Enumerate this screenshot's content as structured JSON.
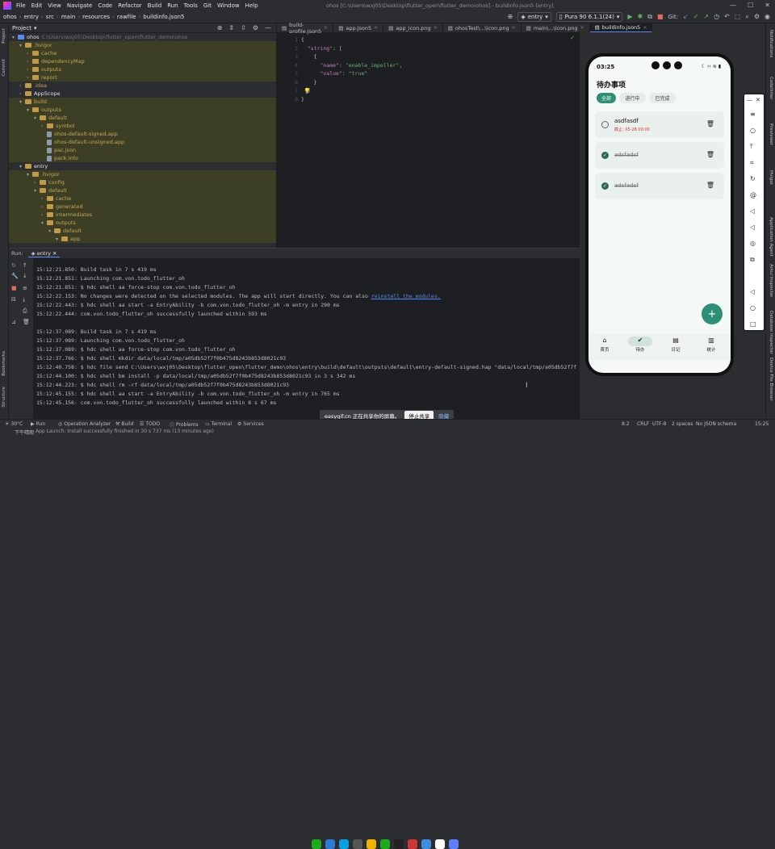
{
  "menubar": {
    "items": [
      "File",
      "Edit",
      "View",
      "Navigate",
      "Code",
      "Refactor",
      "Build",
      "Run",
      "Tools",
      "Git",
      "Window",
      "Help"
    ],
    "title": "ohos [C:\\Users\\wxj05\\Desktop\\flutter_open\\flutter_demo\\ohos] - buildinfo.json5 [entry]"
  },
  "nav": {
    "crumbs": [
      "ohos",
      "entry",
      "src",
      "main",
      "resources",
      "rawfile",
      "buildinfo.json5"
    ],
    "module": "entry",
    "device": "Pura 90 6.1.1(24)",
    "git": "Git:"
  },
  "project": {
    "title": "Project",
    "rows": [
      {
        "d": 0,
        "a": "▾",
        "t": "ohos",
        "sub": "C:\\Users\\wxj05\\Desktop\\flutter_open\\flutter_demo\\ohos",
        "k": "fold",
        "hl": false,
        "dim": false
      },
      {
        "d": 1,
        "a": "▾",
        "t": ".hvigor",
        "k": "fold",
        "hl": true,
        "dim": true
      },
      {
        "d": 2,
        "a": "›",
        "t": "cache",
        "k": "fold",
        "hl": true,
        "dim": true
      },
      {
        "d": 2,
        "a": "›",
        "t": "dependencyMap",
        "k": "fold",
        "hl": true,
        "dim": true
      },
      {
        "d": 2,
        "a": "›",
        "t": "outputs",
        "k": "fold",
        "hl": true,
        "dim": true
      },
      {
        "d": 2,
        "a": "›",
        "t": "report",
        "k": "fold",
        "hl": true,
        "dim": true
      },
      {
        "d": 1,
        "a": "›",
        "t": ".idea",
        "k": "fold",
        "hl": false,
        "dim": true
      },
      {
        "d": 1,
        "a": "›",
        "t": "AppScope",
        "k": "fold",
        "hl": false,
        "dim": false
      },
      {
        "d": 1,
        "a": "▾",
        "t": "build",
        "k": "fold",
        "hl": true,
        "dim": true
      },
      {
        "d": 2,
        "a": "▾",
        "t": "outputs",
        "k": "fold",
        "hl": true,
        "dim": true
      },
      {
        "d": 3,
        "a": "▾",
        "t": "default",
        "k": "fold",
        "hl": true,
        "dim": true
      },
      {
        "d": 4,
        "a": "›",
        "t": "symbol",
        "k": "fold",
        "hl": true,
        "dim": true
      },
      {
        "d": 4,
        "a": "",
        "t": "ohos-default-signed.app",
        "k": "file",
        "hl": true,
        "dim": true
      },
      {
        "d": 4,
        "a": "",
        "t": "ohos-default-unsigned.app",
        "k": "file",
        "hl": true,
        "dim": true
      },
      {
        "d": 4,
        "a": "",
        "t": "pac.json",
        "k": "file",
        "hl": true,
        "dim": true
      },
      {
        "d": 4,
        "a": "",
        "t": "pack.info",
        "k": "file",
        "hl": true,
        "dim": true
      },
      {
        "d": 1,
        "a": "▾",
        "t": "entry",
        "k": "fold",
        "hl": false,
        "dim": false
      },
      {
        "d": 2,
        "a": "▾",
        "t": ".hvigor",
        "k": "fold",
        "hl": true,
        "dim": true
      },
      {
        "d": 3,
        "a": "›",
        "t": "config",
        "k": "fold",
        "hl": true,
        "dim": true
      },
      {
        "d": 3,
        "a": "▾",
        "t": "default",
        "k": "fold",
        "hl": true,
        "dim": true
      },
      {
        "d": 4,
        "a": "›",
        "t": "cache",
        "k": "fold",
        "hl": true,
        "dim": true
      },
      {
        "d": 4,
        "a": "›",
        "t": "generated",
        "k": "fold",
        "hl": true,
        "dim": true
      },
      {
        "d": 4,
        "a": "›",
        "t": "intermediates",
        "k": "fold",
        "hl": true,
        "dim": true
      },
      {
        "d": 4,
        "a": "▾",
        "t": "outputs",
        "k": "fold",
        "hl": true,
        "dim": true
      },
      {
        "d": 5,
        "a": "▾",
        "t": "default",
        "k": "fold",
        "hl": true,
        "dim": true
      },
      {
        "d": 6,
        "a": "▾",
        "t": "app",
        "k": "fold",
        "hl": true,
        "dim": true
      }
    ]
  },
  "tabs": [
    {
      "t": "build-profile.json5",
      "a": false
    },
    {
      "t": "app.json5",
      "a": false
    },
    {
      "t": "app_icon.png",
      "a": false
    },
    {
      "t": "ohosTest\\...\\icon.png",
      "a": false
    },
    {
      "t": "main\\...\\icon.png",
      "a": false
    },
    {
      "t": "buildinfo.json5",
      "a": true
    }
  ],
  "code": [
    {
      "n": "1",
      "p": [
        {
          "c": "br",
          "t": "{"
        }
      ]
    },
    {
      "n": "2",
      "p": [
        {
          "c": "key",
          "t": "  \"string\""
        },
        {
          "c": "br",
          "t": ": ["
        }
      ]
    },
    {
      "n": "3",
      "p": [
        {
          "c": "br",
          "t": "    {"
        }
      ]
    },
    {
      "n": "4",
      "p": [
        {
          "c": "key",
          "t": "      \"name\""
        },
        {
          "c": "br",
          "t": ": "
        },
        {
          "c": "str",
          "t": "\"enable_impeller\""
        },
        {
          "c": "br",
          "t": ","
        }
      ]
    },
    {
      "n": "5",
      "p": [
        {
          "c": "key",
          "t": "      \"value\""
        },
        {
          "c": "br",
          "t": ": "
        },
        {
          "c": "str",
          "t": "\"true\""
        }
      ]
    },
    {
      "n": "6",
      "p": [
        {
          "c": "br",
          "t": "    }"
        }
      ]
    },
    {
      "n": "7",
      "p": [
        {
          "c": "br",
          "t": "  ]"
        }
      ]
    },
    {
      "n": "8",
      "p": [
        {
          "c": "br",
          "t": "}"
        }
      ]
    }
  ],
  "run": {
    "label": "Run:",
    "config": "entry",
    "log": [
      "15:12:21.850: Build task in 7 s 419 ms",
      "15:12:21.851: Launching com.von.todo_flutter_oh",
      "15:12:21.851: $ hdc shell aa force-stop com.von.todo_flutter_oh",
      "15:12:22.153: No changes were detected on the selected modules. The app will start directly. You can also ",
      "15:12:22.443: $ hdc shell aa start -a EntryAbility -b com.von.todo_flutter_oh -m entry in 290 ms",
      "15:12:22.444: com.von.todo_flutter_oh successfully launched within 593 ms",
      "",
      "15:12:37.089: Build task in 7 s 419 ms",
      "15:12:37.089: Launching com.von.todo_flutter_oh",
      "15:12:37.089: $ hdc shell aa force-stop com.von.todo_flutter_oh",
      "15:12:37.766: $ hdc shell mkdir data/local/tmp/a05db52f7f0b475d8243b853d8021c93",
      "15:12:40.758: $ hdc file send C:\\Users\\wxj05\\Desktop\\flutter_open\\flutter_demo\\ohos\\entry\\build\\default\\outputs\\default\\entry-default-signed.hap \"data/local/tmp/a05db52f7f",
      "15:12:44.100: $ hdc shell bm install -p data/local/tmp/a05db52f7f0b475d8243b853d8021c93 in 3 s 342 ms",
      "15:12:44.223: $ hdc shell rm -rf data/local/tmp/a05db52f7f0b475d8243b853d8021c93",
      "15:12:45.155: $ hdc shell aa start -a EntryAbility -b com.von.todo_flutter_oh -m entry in 765 ms",
      "15:12:45.156: com.von.todo_flutter_oh successfully launched within 8 s 67 ms"
    ],
    "link": "reinstall the modules."
  },
  "leftstrip": {
    "project": "Project",
    "commit": "Commit",
    "bookmarks": "Bookmarks",
    "structure": "Structure"
  },
  "rightstrip": [
    "Notifications",
    "Codelinter",
    "Previewer",
    "Hvigor",
    "Application Agent",
    "Arkui Inspector",
    "Database Inspector",
    "Device File Browser"
  ],
  "bottom": {
    "run": "Run",
    "todo": "TODO",
    "problems": "Problems",
    "terminal": "Terminal",
    "services": "Services",
    "opan": "Operation Analyzer",
    "build": "Build",
    "temp": "30°C",
    "weather": "下午晴朗",
    "status": "App Launch: Install successfully finished in 30 s 737 ms (13 minutes ago)",
    "pos": "8:2",
    "crlf": "CRLF",
    "enc": "UTF-8",
    "indent": "2 spaces",
    "schema": "No JSON schema",
    "time": "15:25"
  },
  "share": {
    "text": "easygif.cn 正在共享你的屏幕。",
    "stop": "停止共享",
    "hide": "隐藏"
  },
  "phone": {
    "time": "03:25",
    "title": "待办事项",
    "chips": [
      "全部",
      "进行中",
      "已完成"
    ],
    "items": [
      {
        "title": "asdfasdf",
        "date": "截止: 05-28 00:00",
        "done": false
      },
      {
        "title": "adsfadsf",
        "date": "",
        "done": true
      },
      {
        "title": "adsfadsf",
        "date": "",
        "done": true
      }
    ],
    "nav": [
      {
        "label": "首页",
        "icon": "⌂",
        "sel": false
      },
      {
        "label": "待办",
        "icon": "✔",
        "sel": true
      },
      {
        "label": "日记",
        "icon": "▤",
        "sel": false
      },
      {
        "label": "统计",
        "icon": "▥",
        "sel": false
      }
    ]
  },
  "colors": {
    "accent": "#2d8f76",
    "highlight": "#3d3f24",
    "link": "#548af7"
  }
}
